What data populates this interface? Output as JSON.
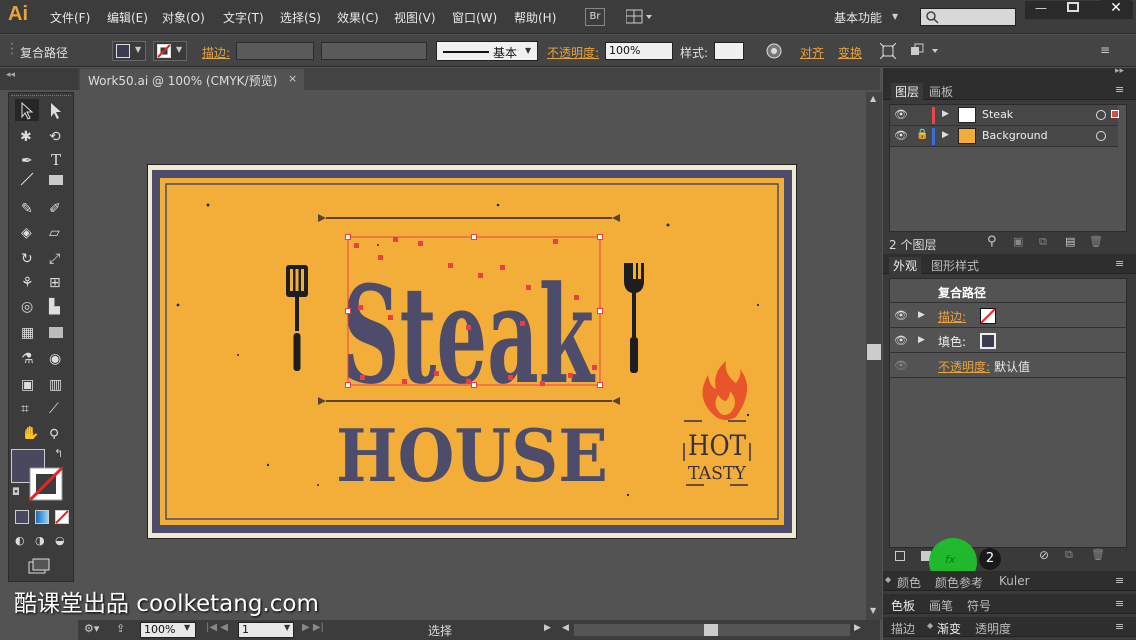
{
  "app": {
    "logo": "Ai",
    "search_placeholder": "",
    "workspace": "基本功能"
  },
  "menu": [
    "文件(F)",
    "编辑(E)",
    "对象(O)",
    "文字(T)",
    "选择(S)",
    "效果(C)",
    "视图(V)",
    "窗口(W)",
    "帮助(H)"
  ],
  "menu_extras": {
    "bridge": "Br"
  },
  "control": {
    "object_type": "复合路径",
    "stroke_label": "描边:",
    "stroke_style": "基本",
    "opacity_label": "不透明度:",
    "opacity_value": "100%",
    "style_label": "样式:",
    "align_label": "对齐",
    "transform_label": "变换"
  },
  "document": {
    "tab_title": "Work50.ai @ 100% (CMYK/预览)",
    "close": "×"
  },
  "artwork": {
    "title": "Steak",
    "subtitle": "HOUSE",
    "badge_line1": "HOT",
    "badge_line2": "TASTY",
    "colors": {
      "background": "#f3ae3a",
      "border": "#4a4a6a",
      "text": "#4a4a6a",
      "selection": "#ee3d4a",
      "flame": "#e8552a"
    }
  },
  "layers_panel": {
    "tabs": [
      "图层",
      "画板"
    ],
    "layers": [
      {
        "name": "Steak",
        "color": "#e24a4a"
      },
      {
        "name": "Background",
        "color": "#3a6fd8"
      }
    ],
    "count": "2 个图层"
  },
  "appearance_panel": {
    "tabs": [
      "外观",
      "图形样式"
    ],
    "header": "复合路径",
    "rows": [
      {
        "label": "描边:",
        "value": ""
      },
      {
        "label": "填色:",
        "value": ""
      },
      {
        "label": "不透明度:",
        "value": "默认值"
      }
    ],
    "badge": "2"
  },
  "bottom_panels": {
    "row1": [
      "颜色",
      "颜色参考",
      "Kuler"
    ],
    "row2": [
      "色板",
      "画笔",
      "符号"
    ],
    "row3": [
      "描边",
      "渐变",
      "透明度"
    ]
  },
  "status": {
    "zoom": "100%",
    "artboard_number": "1",
    "tool_label": "选择"
  },
  "watermark": "酷课堂出品 coolketang.com"
}
